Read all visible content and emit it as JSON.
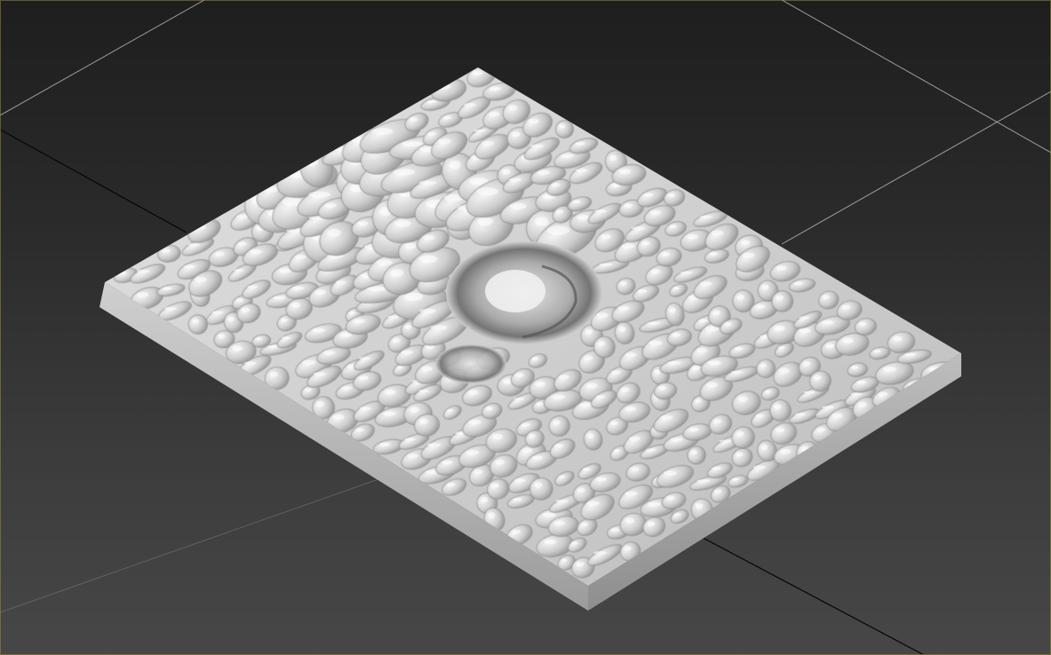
{
  "viewport": {
    "view": "perspective",
    "background_top": "#1e1e1e",
    "background_bottom": "#474747",
    "grid_color": "#bdbdbd",
    "axis_color": "#050505",
    "selection_border": "#9a8a3a"
  },
  "object": {
    "name": "rocky-terrain-tile",
    "shading": "smooth",
    "color": "#c8c8c8"
  }
}
